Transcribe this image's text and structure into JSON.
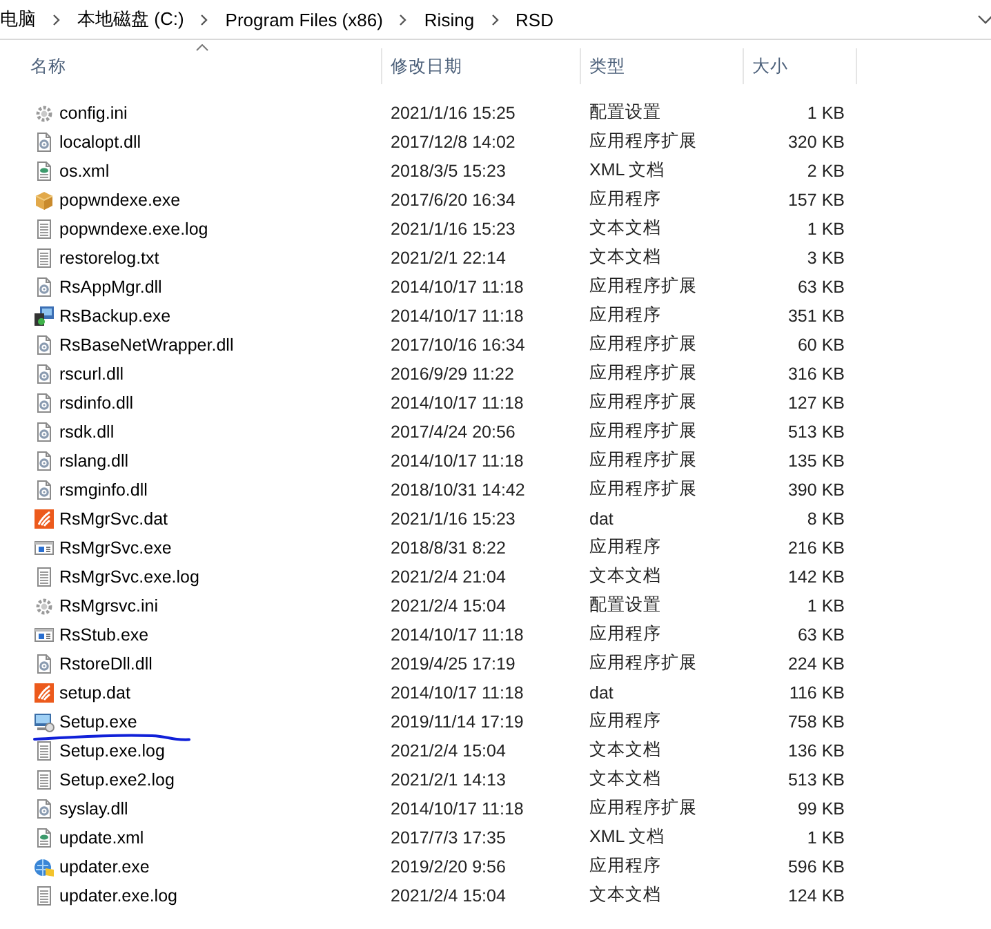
{
  "breadcrumb": [
    "电脑",
    "本地磁盘 (C:)",
    "Program Files (x86)",
    "Rising",
    "RSD"
  ],
  "columns": [
    {
      "label": "名称",
      "sorted": true
    },
    {
      "label": "修改日期",
      "sorted": false
    },
    {
      "label": "类型",
      "sorted": false
    },
    {
      "label": "大小",
      "sorted": false
    }
  ],
  "rows": [
    {
      "kind": "ini",
      "name": "config.ini",
      "date": "2021/1/16 15:25",
      "type": "配置设置",
      "size": "1 KB",
      "underlined": false
    },
    {
      "kind": "dll",
      "name": "localopt.dll",
      "date": "2017/12/8 14:02",
      "type": "应用程序扩展",
      "size": "320 KB",
      "underlined": false
    },
    {
      "kind": "xml",
      "name": "os.xml",
      "date": "2018/3/5 15:23",
      "type": "XML 文档",
      "size": "2 KB",
      "underlined": false
    },
    {
      "kind": "package",
      "name": "popwndexe.exe",
      "date": "2017/6/20 16:34",
      "type": "应用程序",
      "size": "157 KB",
      "underlined": false
    },
    {
      "kind": "text",
      "name": "popwndexe.exe.log",
      "date": "2021/1/16 15:23",
      "type": "文本文档",
      "size": "1 KB",
      "underlined": false
    },
    {
      "kind": "text",
      "name": "restorelog.txt",
      "date": "2021/2/1 22:14",
      "type": "文本文档",
      "size": "3 KB",
      "underlined": false
    },
    {
      "kind": "dll",
      "name": "RsAppMgr.dll",
      "date": "2014/10/17 11:18",
      "type": "应用程序扩展",
      "size": "63 KB",
      "underlined": false
    },
    {
      "kind": "installer",
      "name": "RsBackup.exe",
      "date": "2014/10/17 11:18",
      "type": "应用程序",
      "size": "351 KB",
      "underlined": false
    },
    {
      "kind": "dll",
      "name": "RsBaseNetWrapper.dll",
      "date": "2017/10/16 16:34",
      "type": "应用程序扩展",
      "size": "60 KB",
      "underlined": false
    },
    {
      "kind": "dll",
      "name": "rscurl.dll",
      "date": "2016/9/29 11:22",
      "type": "应用程序扩展",
      "size": "316 KB",
      "underlined": false
    },
    {
      "kind": "dll",
      "name": "rsdinfo.dll",
      "date": "2014/10/17 11:18",
      "type": "应用程序扩展",
      "size": "127 KB",
      "underlined": false
    },
    {
      "kind": "dll",
      "name": "rsdk.dll",
      "date": "2017/4/24 20:56",
      "type": "应用程序扩展",
      "size": "513 KB",
      "underlined": false
    },
    {
      "kind": "dll",
      "name": "rslang.dll",
      "date": "2014/10/17 11:18",
      "type": "应用程序扩展",
      "size": "135 KB",
      "underlined": false
    },
    {
      "kind": "dll",
      "name": "rsmginfo.dll",
      "date": "2018/10/31 14:42",
      "type": "应用程序扩展",
      "size": "390 KB",
      "underlined": false
    },
    {
      "kind": "brand",
      "name": "RsMgrSvc.dat",
      "date": "2021/1/16 15:23",
      "type": "dat",
      "size": "8 KB",
      "underlined": false
    },
    {
      "kind": "window",
      "name": "RsMgrSvc.exe",
      "date": "2018/8/31 8:22",
      "type": "应用程序",
      "size": "216 KB",
      "underlined": false
    },
    {
      "kind": "text",
      "name": "RsMgrSvc.exe.log",
      "date": "2021/2/4 21:04",
      "type": "文本文档",
      "size": "142 KB",
      "underlined": false
    },
    {
      "kind": "ini",
      "name": "RsMgrsvc.ini",
      "date": "2021/2/4 15:04",
      "type": "配置设置",
      "size": "1 KB",
      "underlined": false
    },
    {
      "kind": "window",
      "name": "RsStub.exe",
      "date": "2014/10/17 11:18",
      "type": "应用程序",
      "size": "63 KB",
      "underlined": false
    },
    {
      "kind": "dll",
      "name": "RstoreDll.dll",
      "date": "2019/4/25 17:19",
      "type": "应用程序扩展",
      "size": "224 KB",
      "underlined": false
    },
    {
      "kind": "brand",
      "name": "setup.dat",
      "date": "2014/10/17 11:18",
      "type": "dat",
      "size": "116 KB",
      "underlined": false
    },
    {
      "kind": "setup",
      "name": "Setup.exe",
      "date": "2019/11/14 17:19",
      "type": "应用程序",
      "size": "758 KB",
      "underlined": true
    },
    {
      "kind": "text",
      "name": "Setup.exe.log",
      "date": "2021/2/4 15:04",
      "type": "文本文档",
      "size": "136 KB",
      "underlined": false
    },
    {
      "kind": "text",
      "name": "Setup.exe2.log",
      "date": "2021/2/1 14:13",
      "type": "文本文档",
      "size": "513 KB",
      "underlined": false
    },
    {
      "kind": "dll",
      "name": "syslay.dll",
      "date": "2014/10/17 11:18",
      "type": "应用程序扩展",
      "size": "99 KB",
      "underlined": false
    },
    {
      "kind": "xml",
      "name": "update.xml",
      "date": "2017/7/3 17:35",
      "type": "XML 文档",
      "size": "1 KB",
      "underlined": false
    },
    {
      "kind": "globe",
      "name": "updater.exe",
      "date": "2019/2/20 9:56",
      "type": "应用程序",
      "size": "596 KB",
      "underlined": false
    },
    {
      "kind": "text",
      "name": "updater.exe.log",
      "date": "2021/2/4 15:04",
      "type": "文本文档",
      "size": "124 KB",
      "underlined": false
    }
  ]
}
